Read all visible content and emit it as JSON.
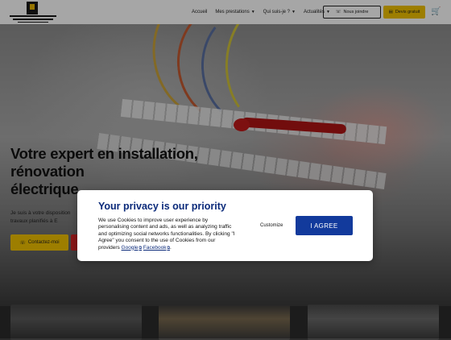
{
  "header": {
    "nav": [
      {
        "label": "Accueil",
        "has_dropdown": false
      },
      {
        "label": "Mes prestations",
        "has_dropdown": true
      },
      {
        "label": "Qui suis-je ?",
        "has_dropdown": true
      },
      {
        "label": "Actualités",
        "has_dropdown": true
      }
    ],
    "phone_button": "Nous joindre",
    "quote_button": "Devis gratuit",
    "icons": {
      "logo": "house-logo",
      "phone": "phone-icon",
      "quote": "document-icon",
      "cart": "cart-icon"
    },
    "accent_color": "#f2c200"
  },
  "hero": {
    "title_lines": [
      "Votre expert en installation,",
      "rénovation",
      "électrique"
    ],
    "text_lines": [
      "Je suis à votre disposition",
      "travaux planifiés à E"
    ],
    "primary_button": "Contactez-moi",
    "secondary_color": "#d42222"
  },
  "consent": {
    "title": "Your privacy is our priority",
    "text": "We use Cookies to improve user experience by personalising content and ads, as well as analyzing traffic and optimizing social networks functionalities. By clicking \"I Agree\" you consent to the use of Cookies from our providers",
    "link_google": "Google",
    "link_facebook": "Facebook",
    "end": ".",
    "customize": "Customize",
    "agree": "I AGREE",
    "brand_color": "#123a9c"
  }
}
